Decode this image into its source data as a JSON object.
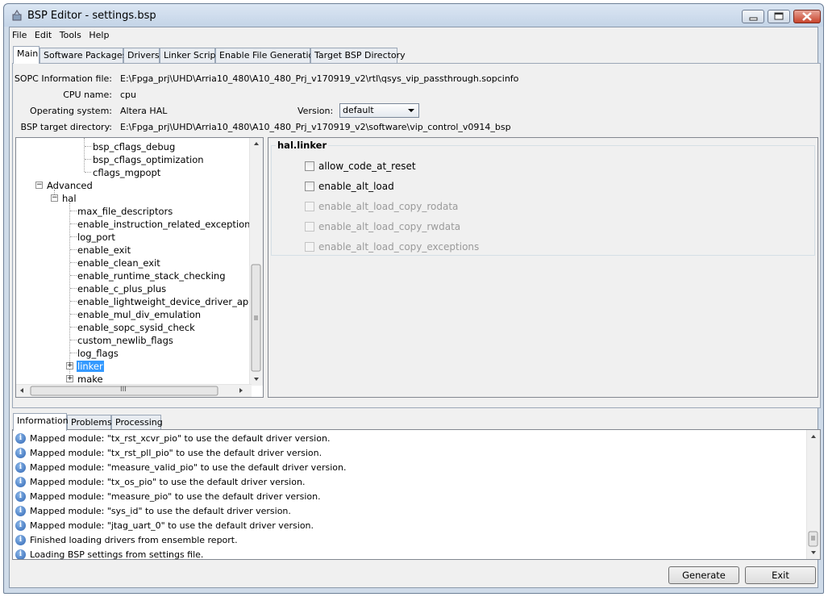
{
  "window": {
    "title": "BSP Editor - settings.bsp"
  },
  "menu": [
    "File",
    "Edit",
    "Tools",
    "Help"
  ],
  "main_tabs": [
    "Main",
    "Software Packages",
    "Drivers",
    "Linker Script",
    "Enable File Generation",
    "Target BSP Directory"
  ],
  "info": {
    "sopc_label": "SOPC Information file:",
    "sopc_value": "E:\\Fpga_prj\\UHD\\Arria10_480\\A10_480_Prj_v170919_v2\\rtl\\qsys_vip_passthrough.sopcinfo",
    "cpu_label": "CPU name:",
    "cpu_value": "cpu",
    "os_label": "Operating system:",
    "os_value": "Altera HAL",
    "version_label": "Version:",
    "version_value": "default",
    "bsp_label": "BSP target directory:",
    "bsp_value": "E:\\Fpga_prj\\UHD\\Arria10_480\\A10_480_Prj_v170919_v2\\software\\vip_control_v0914_bsp"
  },
  "tree": {
    "top_items": [
      "bsp_cflags_debug",
      "bsp_cflags_optimization",
      "cflags_mgpopt"
    ],
    "advanced": "Advanced",
    "hal": "hal",
    "hal_items": [
      "max_file_descriptors",
      "enable_instruction_related_exceptions",
      "log_port",
      "enable_exit",
      "enable_clean_exit",
      "enable_runtime_stack_checking",
      "enable_c_plus_plus",
      "enable_lightweight_device_driver_api",
      "enable_mul_div_emulation",
      "enable_sopc_sysid_check",
      "custom_newlib_flags",
      "log_flags"
    ],
    "linker": "linker",
    "make": "make",
    "hscroll_grip": "III"
  },
  "detail": {
    "group_title": "hal.linker",
    "options": [
      {
        "label": "allow_code_at_reset",
        "enabled": true
      },
      {
        "label": "enable_alt_load",
        "enabled": true
      },
      {
        "label": "enable_alt_load_copy_rodata",
        "enabled": false
      },
      {
        "label": "enable_alt_load_copy_rwdata",
        "enabled": false
      },
      {
        "label": "enable_alt_load_copy_exceptions",
        "enabled": false
      }
    ]
  },
  "bottom_tabs": [
    "Information",
    "Problems",
    "Processing"
  ],
  "log": [
    "Mapped module: \"tx_rst_xcvr_pio\" to use the default driver version.",
    "Mapped module: \"tx_rst_pll_pio\" to use the default driver version.",
    "Mapped module: \"measure_valid_pio\" to use the default driver version.",
    "Mapped module: \"tx_os_pio\" to use the default driver version.",
    "Mapped module: \"measure_pio\" to use the default driver version.",
    "Mapped module: \"sys_id\" to use the default driver version.",
    "Mapped module: \"jtag_uart_0\" to use the default driver version.",
    "Finished loading drivers from ensemble report.",
    "Loading BSP settings from settings file."
  ],
  "buttons": {
    "generate": "Generate",
    "exit": "Exit"
  }
}
